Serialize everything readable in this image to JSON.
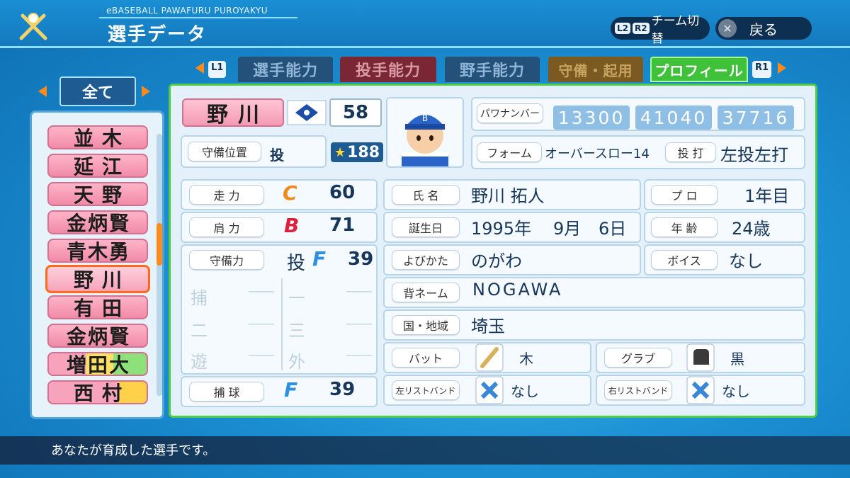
{
  "header": {
    "brand": "eBASEBALL PAWAFURU PUROYAKYU",
    "title": "選手データ",
    "team_switch_tags": [
      "L2",
      "R2"
    ],
    "team_switch_label": "チーム切替",
    "back_label": "戻る"
  },
  "tabs": {
    "left_btn": "L1",
    "right_btn": "R1",
    "items": [
      "選手能力",
      "投手能力",
      "野手能力",
      "守備・起用",
      "プロフィール"
    ],
    "active": "プロフィール"
  },
  "filter": {
    "label": "全て"
  },
  "player_list": [
    "並木",
    "延江",
    "天野",
    "金炳賢",
    "青木勇",
    "野川",
    "有田",
    "金炳賢",
    "増田大",
    "西村"
  ],
  "selected_player": "野川",
  "player": {
    "name": "野川",
    "number": "58",
    "position_label": "守備位置",
    "position": "投",
    "rating": "188",
    "pawa_number_label": "パワナンバー",
    "pawa_numbers": [
      "13300",
      "41040",
      "37716"
    ],
    "form_label": "フォーム",
    "form": "オーバースロー14",
    "throw_bat_label": "投 打",
    "throw_bat": "左投左打"
  },
  "abilities": {
    "speed_label": "走 力",
    "speed_grade": "C",
    "speed_value": "60",
    "arm_label": "肩 力",
    "arm_grade": "B",
    "arm_value": "71",
    "defense_label": "守備力",
    "defense_pos": "投",
    "defense_grade": "F",
    "defense_value": "39",
    "sub_positions": [
      {
        "pos": "捕",
        "value": "――"
      },
      {
        "pos": "一",
        "value": "――"
      },
      {
        "pos": "二",
        "value": "――"
      },
      {
        "pos": "三",
        "value": "――"
      },
      {
        "pos": "遊",
        "value": "――"
      },
      {
        "pos": "外",
        "value": "――"
      }
    ],
    "catch_label": "捕 球",
    "catch_grade": "F",
    "catch_value": "39"
  },
  "profile": {
    "name_label": "氏 名",
    "full_name": "野川 拓人",
    "pro_label": "プ ロ",
    "pro_years": "1年目",
    "birth_label": "誕生日",
    "birth_year": "1995年",
    "birth_month": "9月",
    "birth_day": "6日",
    "age_label": "年 齢",
    "age": "24歳",
    "reading_label": "よびかた",
    "reading": "のがわ",
    "voice_label": "ボイス",
    "voice": "なし",
    "jersey_label": "背ネーム",
    "jersey_name": "NOGAWA",
    "region_label": "国・地域",
    "region": "埼玉",
    "bat_label": "バット",
    "bat": "木",
    "glove_label": "グラブ",
    "glove": "黒",
    "lwrist_label": "左リストバンド",
    "lwrist": "なし",
    "rwrist_label": "右リストバンド",
    "rwrist": "なし"
  },
  "footer": {
    "help": "あなたが育成した選手です。"
  },
  "colors": {
    "grade_C": "#f08a1c",
    "grade_B": "#e0203a",
    "grade_F": "#2f8fe0",
    "active_tab": "#3fc23a",
    "selected_outline": "#ff6a1a"
  },
  "icons": [
    "baseball-bats-icon",
    "team-logo-icon",
    "star-icon",
    "player-avatar-icon",
    "bat-icon",
    "glove-icon",
    "x-mark-icon"
  ]
}
